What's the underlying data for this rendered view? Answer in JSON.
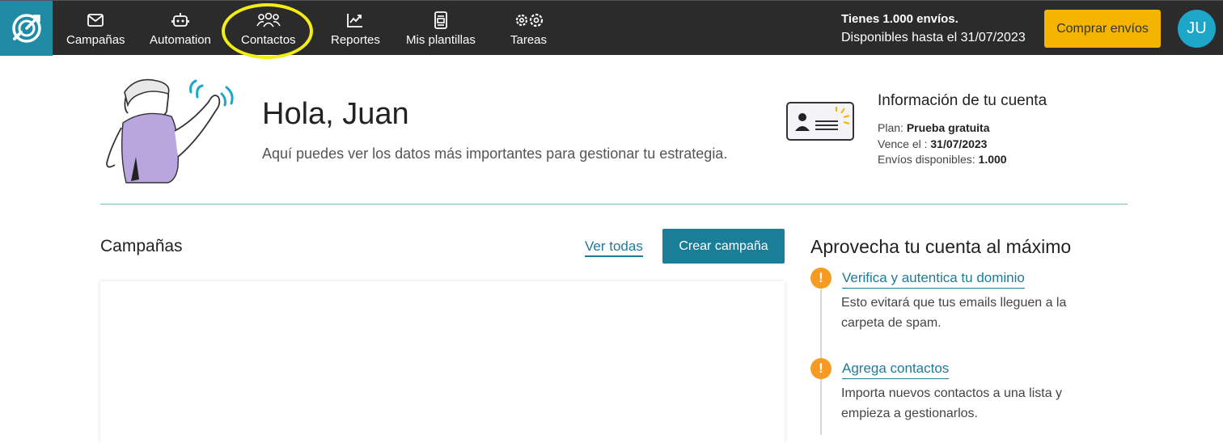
{
  "nav": {
    "items": [
      {
        "label": "Campañas",
        "icon": "envelope-icon"
      },
      {
        "label": "Automation",
        "icon": "robot-icon"
      },
      {
        "label": "Contactos",
        "icon": "users-icon"
      },
      {
        "label": "Reportes",
        "icon": "chart-icon"
      },
      {
        "label": "Mis plantillas",
        "icon": "template-icon"
      },
      {
        "label": "Tareas",
        "icon": "gears-icon"
      }
    ],
    "envios_line1": "Tienes 1.000 envíos.",
    "envios_line2": "Disponibles hasta el 31/07/2023",
    "buy_label": "Comprar envíos",
    "avatar_initials": "JU"
  },
  "hero": {
    "greeting": "Hola, Juan",
    "subtitle": "Aquí puedes ver los datos más importantes para gestionar tu estrategia."
  },
  "account": {
    "title": "Información de tu cuenta",
    "plan_label": "Plan: ",
    "plan_value": "Prueba gratuita",
    "expires_label": "Vence el : ",
    "expires_value": "31/07/2023",
    "sends_label": "Envíos disponibles: ",
    "sends_value": "1.000"
  },
  "campaigns": {
    "title": "Campañas",
    "view_all": "Ver todas",
    "create": "Crear campaña"
  },
  "tips": {
    "title": "Aprovecha tu cuenta al máximo",
    "items": [
      {
        "link": "Verifica y autentica tu dominio",
        "desc": "Esto evitará que tus emails lleguen a la carpeta de spam."
      },
      {
        "link": "Agrega contactos",
        "desc": "Importa nuevos contactos a una lista y empieza a gestionarlos."
      }
    ]
  },
  "colors": {
    "topbar": "#2b2b2b",
    "logo_bg": "#1f8ba5",
    "buy_button": "#f5b400",
    "primary": "#1a7e99",
    "warning": "#f59a23",
    "highlight": "#f2ee14"
  }
}
